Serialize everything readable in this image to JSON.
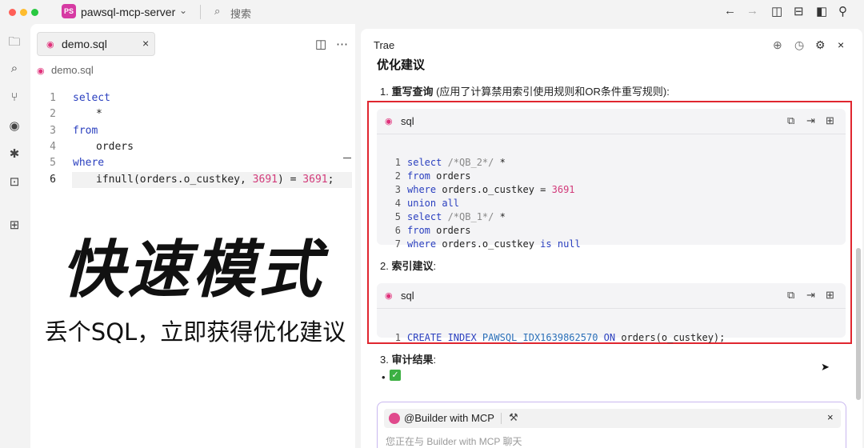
{
  "titlebar": {
    "project_badge": "PS",
    "project_name": "pawsql-mcp-server",
    "search_placeholder": "搜索"
  },
  "editor": {
    "tab_label": "demo.sql",
    "breadcrumb": "demo.sql",
    "lines": [
      {
        "no": "1",
        "text": "select"
      },
      {
        "no": "2",
        "text": "*"
      },
      {
        "no": "3",
        "text": "from"
      },
      {
        "no": "4",
        "text": "orders"
      },
      {
        "no": "5",
        "text": "where"
      },
      {
        "no": "6",
        "fn": "ifnull(orders.o_custkey, ",
        "n1": "3691",
        "mid": ") = ",
        "n2": "3691",
        "end": ";"
      }
    ]
  },
  "overlay": {
    "headline": "快速模式",
    "subline": "丢个SQL，立即获得优化建议"
  },
  "chat": {
    "title": "Trae",
    "partial_heading": "优化建议",
    "item1_prefix": "1. ",
    "item1_bold": "重写查询",
    "item1_rest": " (应用了计算禁用索引使用规则和OR条件重写规则):",
    "block1_lang": "sql",
    "block1_lines": [
      {
        "no": "1",
        "a": "select ",
        "cm": "/*QB_2*/",
        "b": " *"
      },
      {
        "no": "2",
        "a": "from",
        "b": " orders"
      },
      {
        "no": "3",
        "a": "where",
        "b": " orders.o_custkey = ",
        "num": "3691"
      },
      {
        "no": "4",
        "a": "union all"
      },
      {
        "no": "5",
        "a": "select ",
        "cm": "/*QB_1*/",
        "b": " *"
      },
      {
        "no": "6",
        "a": "from",
        "b": " orders"
      },
      {
        "no": "7",
        "a": "where",
        "b": " orders.o_custkey ",
        "kw2": "is null"
      }
    ],
    "item2_prefix": "2. ",
    "item2_bold": "索引建议",
    "item2_rest": ":",
    "block2_lang": "sql",
    "block2_line": {
      "no": "1",
      "kw": "CREATE INDEX ",
      "id": "PAWSQL_IDX1639862570",
      "kw2": " ON ",
      "rest": "orders(o_custkey);"
    },
    "item3_prefix": "3. ",
    "item3_bold": "审计结果",
    "item3_rest": ":",
    "bullet": "•",
    "check_mark": "✓",
    "input_chip": "@Builder with MCP",
    "input_placeholder": "您正在与 Builder with MCP 聊天"
  },
  "colors": {
    "accent_red": "#e0262f",
    "project_badge": "#d63aa3",
    "keyword": "#2a3fbf",
    "number": "#d23a7a"
  }
}
